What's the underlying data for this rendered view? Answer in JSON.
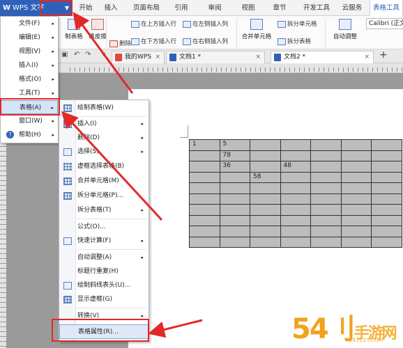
{
  "app": {
    "logo": "W",
    "name": "WPS 文字"
  },
  "ribbon_tabs": [
    "开始",
    "插入",
    "页面布局",
    "引用",
    "审阅",
    "视图",
    "章节",
    "开发工具",
    "云服务",
    "表格工具"
  ],
  "ribbon": {
    "draw_table": "制表格",
    "eraser": "橡皮擦",
    "delete": "删除",
    "insert_above": "在上方插入行",
    "insert_below": "在下方插入行",
    "insert_left": "在左侧插入列",
    "insert_right": "在右侧插入列",
    "merge_cells": "合并单元格",
    "split_cells": "拆分单元格",
    "split_table": "拆分表格",
    "autofit": "自动调整",
    "font": "Calibri (正文"
  },
  "doc_tabs": [
    {
      "label": "我的WPS",
      "active": false
    },
    {
      "label": "文档1 *",
      "active": false
    },
    {
      "label": "文档2 *",
      "active": true
    }
  ],
  "app_menu": {
    "items": [
      {
        "label": "文件(F)",
        "sub": "▸"
      },
      {
        "label": "编辑(E)",
        "sub": "▸"
      },
      {
        "label": "视图(V)",
        "sub": "▸"
      },
      {
        "label": "插入(I)",
        "sub": "▸"
      },
      {
        "label": "格式(O)",
        "sub": "▸"
      },
      {
        "label": "工具(T)",
        "sub": "▸"
      },
      {
        "label": "表格(A)",
        "sub": "▸"
      },
      {
        "label": "窗口(W)",
        "sub": "▸"
      },
      {
        "label": "帮助(H)",
        "sub": "▸"
      }
    ]
  },
  "table_menu": {
    "items": [
      {
        "label": "绘制表格(W)",
        "sub": ""
      },
      {
        "label": "插入(I)",
        "sub": "▸"
      },
      {
        "label": "删除(D)",
        "sub": "▸"
      },
      {
        "label": "选择(S)",
        "sub": "▸"
      },
      {
        "label": "虚框选择表格(B)",
        "sub": ""
      },
      {
        "label": "合并单元格(M)",
        "sub": ""
      },
      {
        "label": "拆分单元格(P)...",
        "sub": ""
      },
      {
        "label": "拆分表格(T)",
        "sub": "▸"
      },
      {
        "label": "公式(O)...",
        "sub": ""
      },
      {
        "label": "快速计算(F)",
        "sub": "▸"
      },
      {
        "label": "自动调整(A)",
        "sub": "▸"
      },
      {
        "label": "标题行重复(H)",
        "sub": ""
      },
      {
        "label": "绘制斜线表头(U)...",
        "sub": ""
      },
      {
        "label": "显示虚框(G)",
        "sub": ""
      },
      {
        "label": "转换(V)",
        "sub": "▸"
      },
      {
        "label": "表格属性(R)...",
        "sub": ""
      }
    ]
  },
  "doc_table": [
    [
      "1",
      "5",
      "",
      "",
      "",
      "",
      ""
    ],
    [
      "",
      "78",
      "",
      "",
      "",
      "",
      ""
    ],
    [
      "",
      "36",
      "",
      "48",
      "",
      "",
      ""
    ],
    [
      "",
      "",
      "58",
      "",
      "",
      "",
      ""
    ],
    [
      "",
      "",
      "",
      "",
      "",
      "",
      ""
    ],
    [
      "",
      "",
      "",
      "",
      "",
      "",
      ""
    ],
    [
      "",
      "",
      "",
      "",
      "",
      "",
      ""
    ],
    [
      "",
      "",
      "",
      "",
      "",
      "",
      ""
    ],
    [
      "",
      "",
      "",
      "",
      "",
      "",
      ""
    ],
    [
      "",
      "",
      "",
      "",
      "",
      "",
      ""
    ]
  ],
  "watermark": {
    "text": "54刂",
    "suffix": "手游网",
    "url": "5411SY.COM"
  },
  "colors": {
    "accent": "#2f61b8",
    "annotation": "#e32828"
  }
}
